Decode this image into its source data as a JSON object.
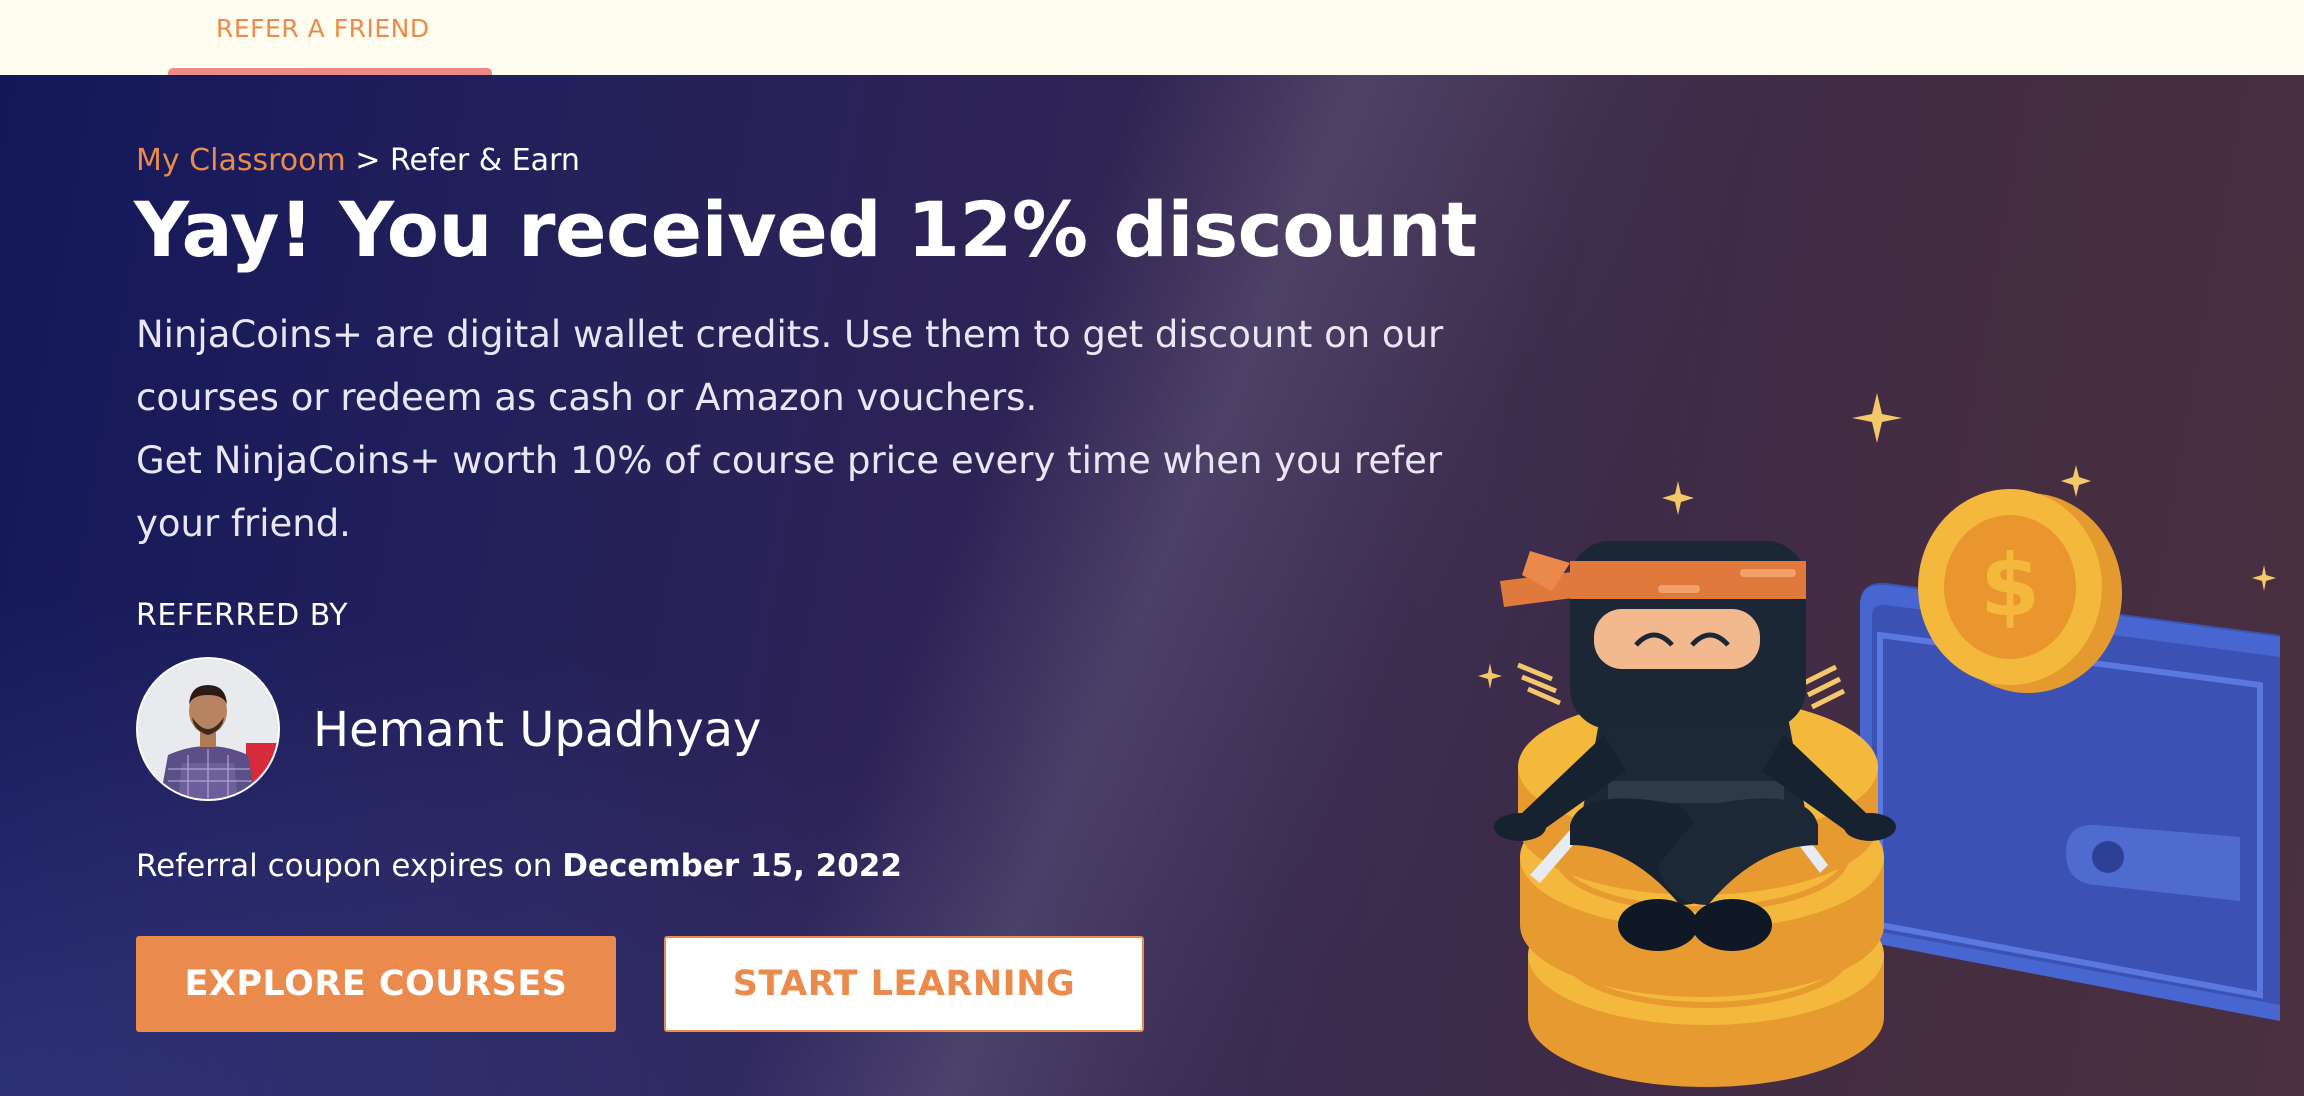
{
  "top_nav": {
    "tab_label": "REFER A FRIEND"
  },
  "breadcrumb": {
    "parent": "My Classroom",
    "separator": ">",
    "current": "Refer & Earn"
  },
  "hero": {
    "title": "Yay! You received 12% discount",
    "description_line1": "NinjaCoins+ are digital wallet credits. Use them to get discount on our courses or redeem as cash or Amazon vouchers.",
    "description_line2": "Get NinjaCoins+ worth 10% of course price every time when you refer your friend."
  },
  "referral": {
    "label": "REFERRED BY",
    "name": "Hemant Upadhyay",
    "expiry_prefix": "Referral coupon expires on",
    "expiry_date": "December 15, 2022"
  },
  "buttons": {
    "explore": "EXPLORE COURSES",
    "start": "START LEARNING"
  },
  "colors": {
    "accent": "#ea8a4c",
    "topbar_bg": "#fefcef",
    "hero_bg_start": "#13175a",
    "hero_bg_end": "#4a3040",
    "coin": "#f3b63f",
    "wallet": "#3b52b4"
  },
  "icons": {
    "coin_symbol": "$",
    "sparkle": "sparkle-icon"
  }
}
